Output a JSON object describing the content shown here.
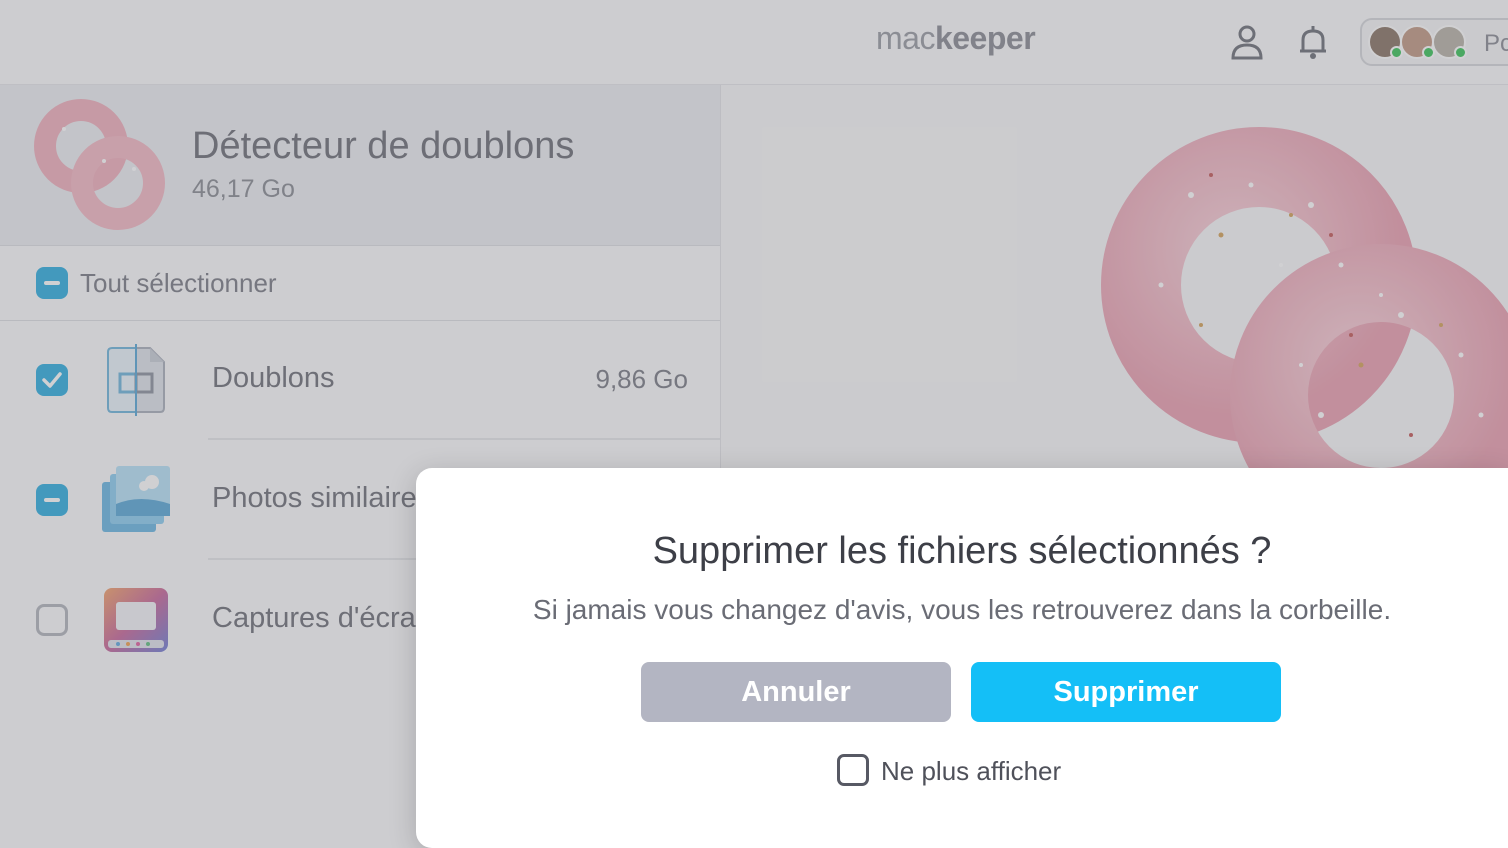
{
  "header": {
    "logo_mac": "mac",
    "logo_keeper": "keeper",
    "avatar_more": "Pc"
  },
  "category": {
    "title": "Détecteur de doublons",
    "size": "46,17 Go"
  },
  "select_all": {
    "label": "Tout sélectionner",
    "state": "partial"
  },
  "items": [
    {
      "label": "Doublons",
      "size": "9,86 Go",
      "state": "checked",
      "icon": "duplicate-file-icon"
    },
    {
      "label": "Photos similaires",
      "size": "",
      "state": "partial",
      "icon": "photos-icon"
    },
    {
      "label": "Captures d'écran",
      "size": "",
      "state": "unchecked",
      "icon": "screenshot-icon"
    }
  ],
  "dialog": {
    "title": "Supprimer les fichiers sélectionnés ?",
    "message": "Si jamais vous changez d'avis, vous les retrouverez dans la corbeille.",
    "cancel_label": "Annuler",
    "delete_label": "Supprimer",
    "dont_show_label": "Ne plus afficher",
    "dont_show_checked": false
  },
  "colors": {
    "accent": "#14bff7",
    "checkbox": "#30aee0",
    "cancel": "#b3b5c2",
    "donut": "#f2a9b8"
  }
}
